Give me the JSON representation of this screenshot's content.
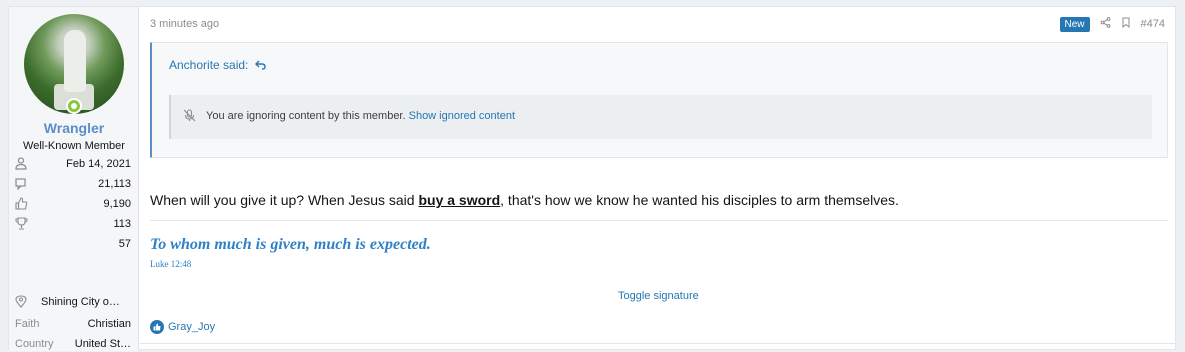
{
  "user": {
    "name": "Wrangler",
    "title": "Well-Known Member",
    "joined": "Feb 14, 2021",
    "messages": "21,113",
    "reactions": "9,190",
    "points": "113",
    "extra": "57",
    "location": "Shining City o…",
    "faith_label": "Faith",
    "faith": "Christian",
    "country_label": "Country",
    "country": "United St…"
  },
  "post": {
    "time": "3 minutes ago",
    "new_badge": "New",
    "number": "#474",
    "quote_author": "Anchorite said:",
    "ignored_text": "You are ignoring content by this member.",
    "show_ignored": "Show ignored content",
    "body_before": "When will you give it up? When Jesus said ",
    "body_link": "buy a sword",
    "body_after": ", that's how we know he wanted his disciples to arm themselves.",
    "signature": "To whom much is given, much is expected.",
    "signature_ref": "Luke 12:48",
    "toggle_signature": "Toggle signature",
    "reactor": "Gray_Joy"
  },
  "icons": {
    "joined": "user-icon",
    "messages": "messages-icon",
    "reactions": "thumbs-up-icon",
    "points": "trophy-icon",
    "location": "location-pin-icon",
    "share": "share-icon",
    "bookmark": "bookmark-icon",
    "reply": "reply-arrow-icon",
    "mute": "muted-mic-icon",
    "like": "like-icon"
  },
  "colors": {
    "accent": "#2577b1",
    "username": "#5b8fc6",
    "online": "#8cc63f"
  }
}
